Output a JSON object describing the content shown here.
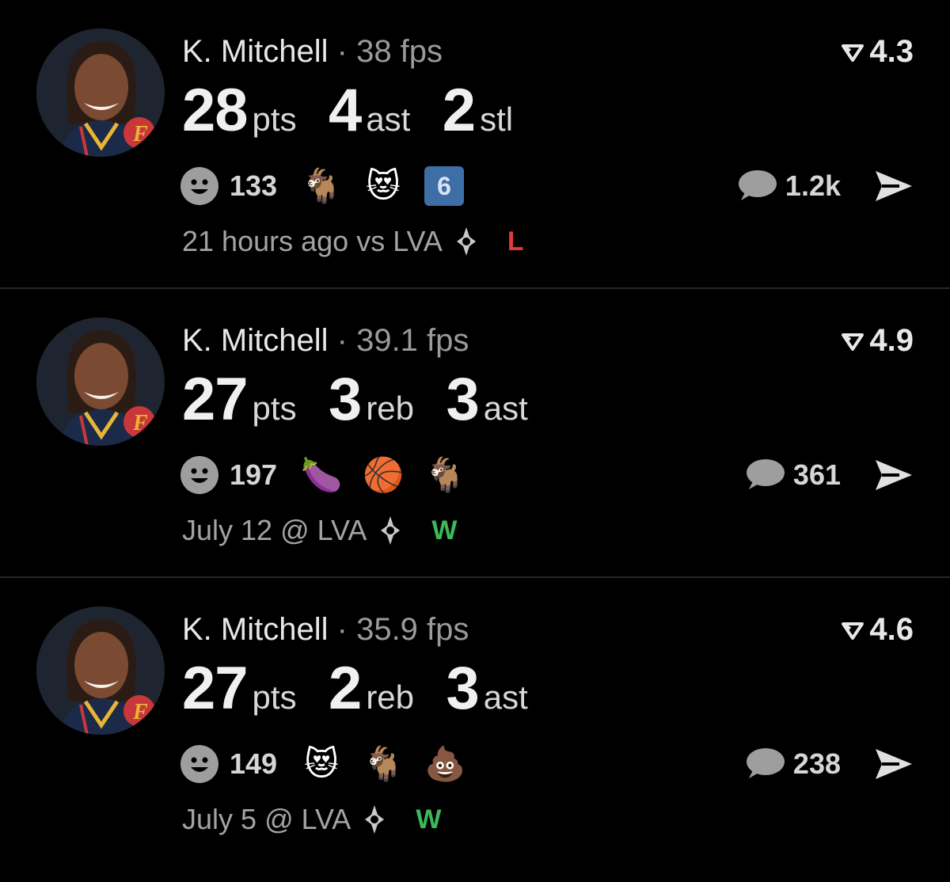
{
  "colors": {
    "win": "#3db85a",
    "loss": "#e23b3b",
    "muted": "#9a9a9a"
  },
  "posts": [
    {
      "player": "K. Mitchell",
      "separator": "·",
      "fps": "38 fps",
      "rating": "4.3",
      "stats": [
        {
          "value": "28",
          "unit": "pts"
        },
        {
          "value": "4",
          "unit": "ast"
        },
        {
          "value": "2",
          "unit": "stl"
        }
      ],
      "reaction_icon": "smiley-icon",
      "reaction_count": "133",
      "emojis": [
        "🐐",
        "😻",
        "6"
      ],
      "comment_count": "1.2k",
      "time": "21 hours ago",
      "opponent": "vs LVA",
      "result": "L"
    },
    {
      "player": "K. Mitchell",
      "separator": "·",
      "fps": "39.1 fps",
      "rating": "4.9",
      "stats": [
        {
          "value": "27",
          "unit": "pts"
        },
        {
          "value": "3",
          "unit": "reb"
        },
        {
          "value": "3",
          "unit": "ast"
        }
      ],
      "reaction_icon": "smiley-icon",
      "reaction_count": "197",
      "emojis": [
        "🍆",
        "🏀",
        "🐐"
      ],
      "comment_count": "361",
      "time": "July 12",
      "opponent": "@ LVA",
      "result": "W"
    },
    {
      "player": "K. Mitchell",
      "separator": "·",
      "fps": "35.9 fps",
      "rating": "4.6",
      "stats": [
        {
          "value": "27",
          "unit": "pts"
        },
        {
          "value": "2",
          "unit": "reb"
        },
        {
          "value": "3",
          "unit": "ast"
        }
      ],
      "reaction_icon": "smiley-icon",
      "reaction_count": "149",
      "emojis": [
        "😻",
        "🐐",
        "💩"
      ],
      "comment_count": "238",
      "time": "July 5",
      "opponent": "@ LVA",
      "result": "W"
    }
  ]
}
